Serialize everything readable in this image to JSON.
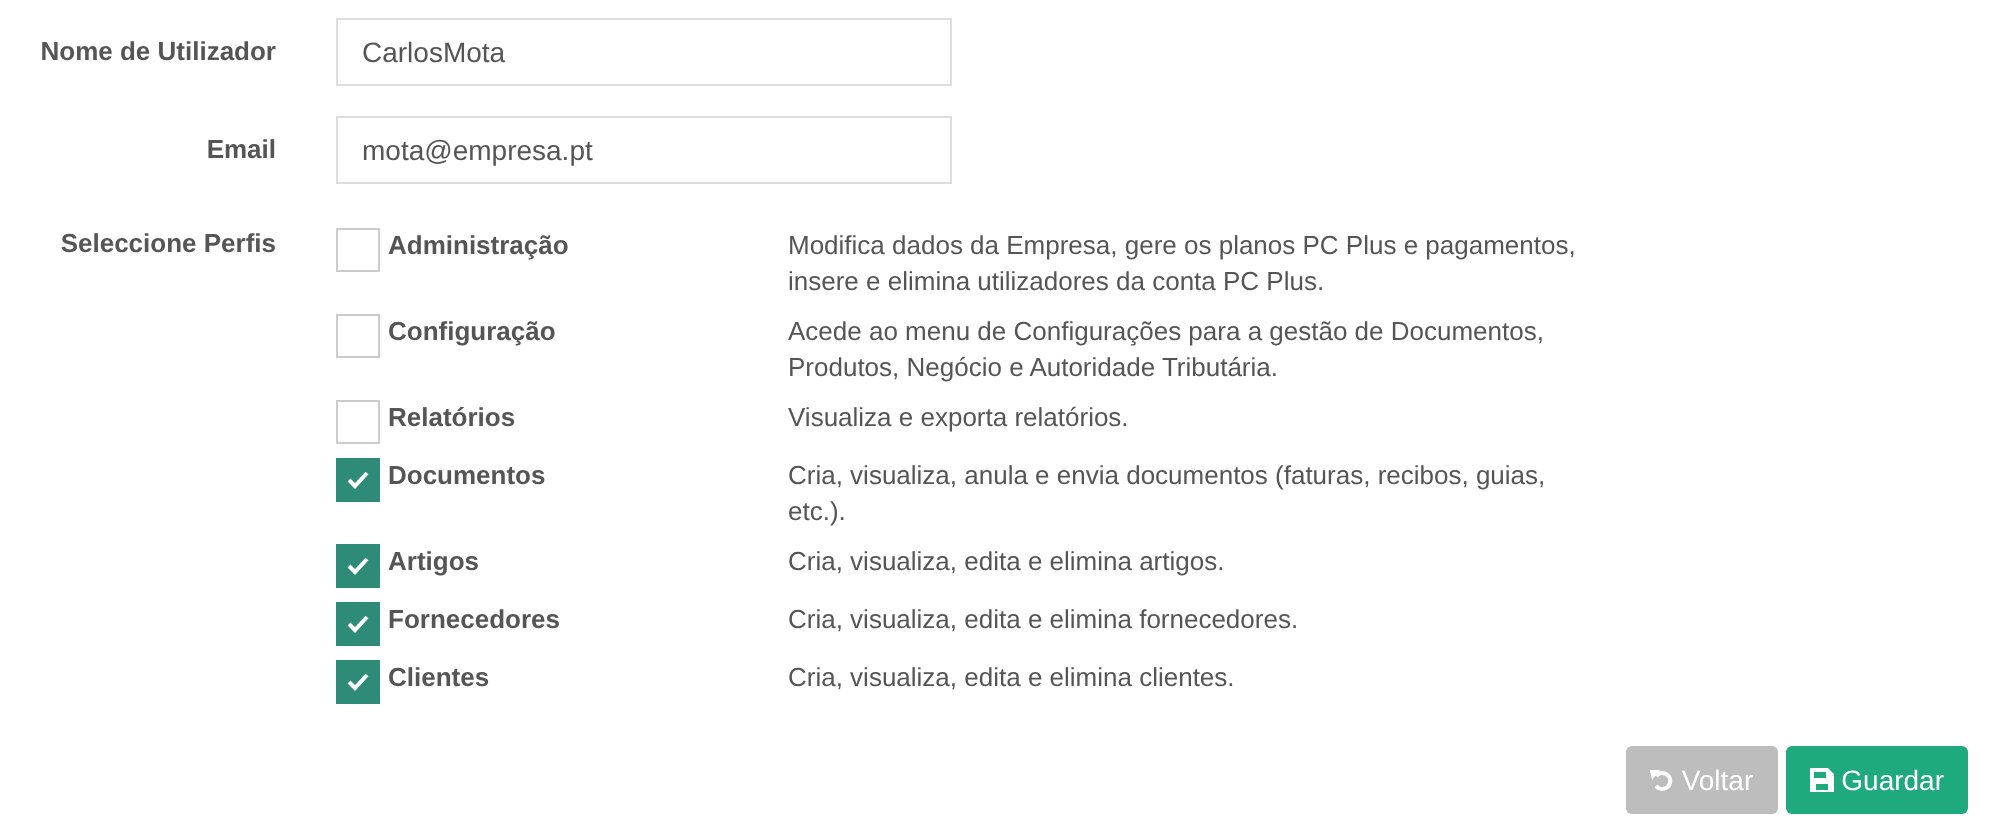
{
  "fields": [
    {
      "label": "Nome de Utilizador",
      "value": "CarlosMota"
    },
    {
      "label": "Email",
      "value": "mota@empresa.pt"
    }
  ],
  "profiles": {
    "label": "Seleccione Perfis",
    "items": [
      {
        "name": "Administração",
        "description": "Modifica dados da Empresa, gere os planos PC Plus e pagamentos, insere e elimina utilizadores da conta PC Plus.",
        "checked": false
      },
      {
        "name": "Configuração",
        "description": "Acede ao menu de Configurações para a gestão de Documentos, Produtos, Negócio e Autoridade Tributária.",
        "checked": false
      },
      {
        "name": "Relatórios",
        "description": "Visualiza e exporta relatórios.",
        "checked": false
      },
      {
        "name": "Documentos",
        "description": "Cria, visualiza, anula e envia documentos (faturas, recibos, guias, etc.).",
        "checked": true
      },
      {
        "name": "Artigos",
        "description": "Cria, visualiza, edita e elimina artigos.",
        "checked": true
      },
      {
        "name": "Fornecedores",
        "description": "Cria, visualiza, edita e elimina fornecedores.",
        "checked": true
      },
      {
        "name": "Clientes",
        "description": "Cria, visualiza, edita e elimina clientes.",
        "checked": true
      }
    ]
  },
  "buttons": [
    {
      "kind": "back",
      "label": "Voltar",
      "disabled": true
    },
    {
      "kind": "save",
      "label": "Guardar",
      "disabled": false
    }
  ]
}
